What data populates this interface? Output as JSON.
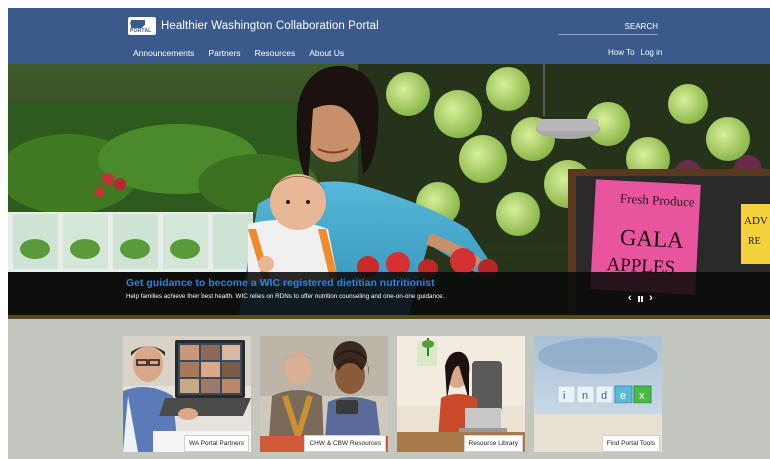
{
  "header": {
    "logo_badge": "WA PORTAL",
    "title": "Healthier Washington Collaboration Portal",
    "search_placeholder": "SEARCH",
    "nav": [
      {
        "label": "Announcements"
      },
      {
        "label": "Partners"
      },
      {
        "label": "Resources"
      },
      {
        "label": "About Us"
      }
    ],
    "utility": [
      {
        "label": "How To"
      },
      {
        "label": "Log in"
      }
    ]
  },
  "hero": {
    "sign_fresh": "Fresh Produce",
    "sign_gala": "GALA",
    "sign_apples": "APPLES",
    "sign_edge_1": "ADV",
    "sign_edge_2": "RE",
    "caption_title": "Get guidance to become a WIC registered dietitian nutritionist",
    "caption_text": "Help families achieve their best health. WIC relies on RDNs to offer nutrition counseling and one-on-one guidance.",
    "prev_symbol": "‹",
    "next_symbol": "›"
  },
  "cards": [
    {
      "label": "WA Portal Partners",
      "icon": "video-call-image"
    },
    {
      "label": "CHW & CBW Resources",
      "icon": "community-workers-image"
    },
    {
      "label": "Resource Library",
      "icon": "laptop-student-image"
    },
    {
      "label": "Find Portal Tools",
      "icon": "index-blocks-image"
    }
  ],
  "index_blocks": [
    "i",
    "n",
    "d",
    "e",
    "x"
  ],
  "colors": {
    "header_bg": "#3a5a8c",
    "caption_title": "#2f80d8",
    "cards_bg": "#c4c7c0",
    "sign_pink": "#e8559e",
    "sign_yellow": "#f3d23b"
  }
}
